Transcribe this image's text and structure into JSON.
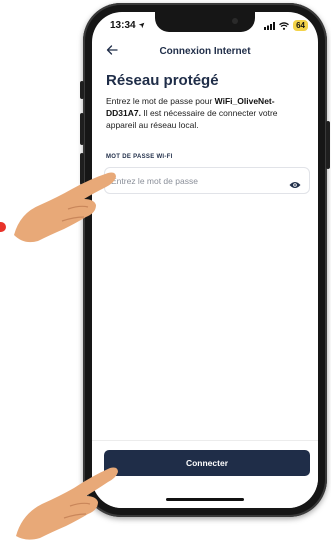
{
  "status_bar": {
    "time": "13:34",
    "battery": "64"
  },
  "nav": {
    "title": "Connexion Internet"
  },
  "content": {
    "heading": "Réseau protégé",
    "desc_before": "Entrez le mot de passe pour ",
    "network_name": "WiFi_OliveNet-DD31A7.",
    "desc_after": " Il est nécessaire de connecter votre appareil au réseau local."
  },
  "password_field": {
    "label": "MOT DE PASSE WI-FI",
    "placeholder": "Entrez le mot de passe",
    "value": ""
  },
  "connect_button": {
    "label": "Connecter"
  },
  "colors": {
    "primary": "#1f2d48",
    "battery": "#f3d34a",
    "accent_dot": "#e8332a"
  }
}
